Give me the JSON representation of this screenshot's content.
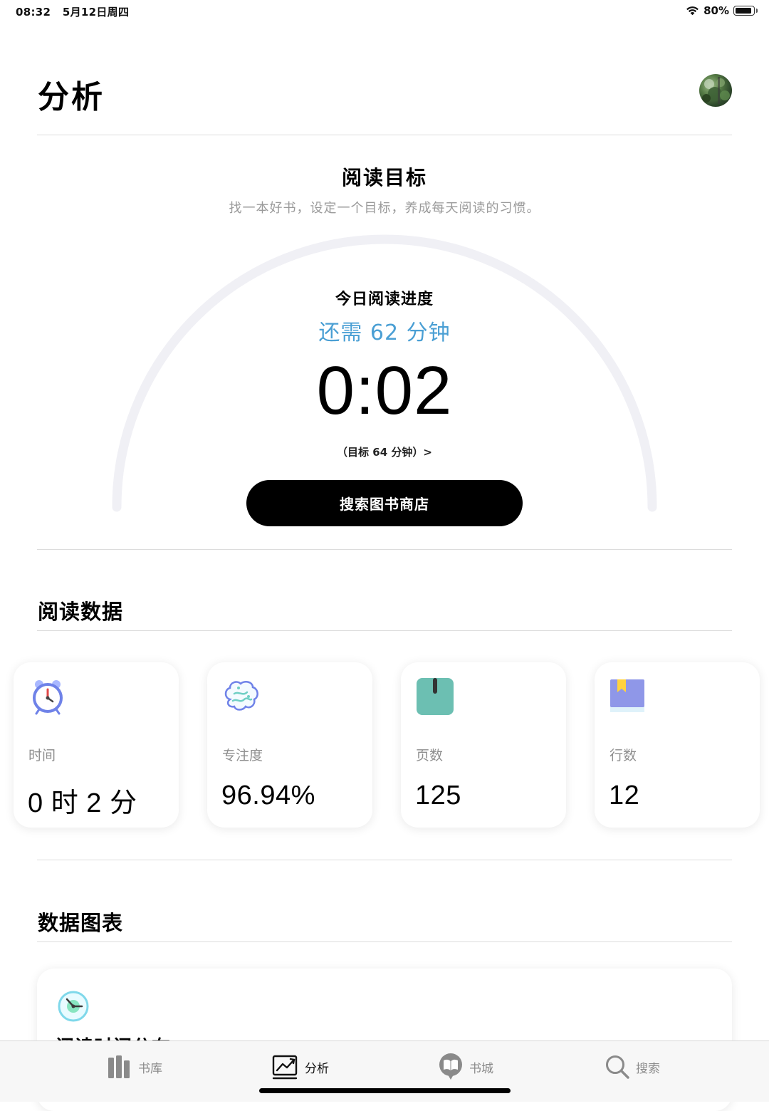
{
  "status_bar": {
    "time": "08:32",
    "date": "5月12日周四",
    "battery": "80%",
    "wifi_icon": "wifi-icon",
    "battery_icon": "battery-icon"
  },
  "header": {
    "title": "分析",
    "avatar_icon": "avatar"
  },
  "goal": {
    "title": "阅读目标",
    "subtitle": "找一本好书，设定一个目标，养成每天阅读的习惯。",
    "progress_label": "今日阅读进度",
    "remaining": "还需 62 分钟",
    "timer": "0:02",
    "target": "（目标 64 分钟）>",
    "button_label": "搜索图书商店",
    "progress_fraction": 0.03,
    "accent_color": "#4a9fd4"
  },
  "reading_data": {
    "title": "阅读数据",
    "cards": [
      {
        "label": "时间",
        "value": "0 时 2 分",
        "icon": "alarm-clock-icon"
      },
      {
        "label": "专注度",
        "value": "96.94%",
        "icon": "brain-icon"
      },
      {
        "label": "页数",
        "value": "125",
        "icon": "page-icon"
      },
      {
        "label": "行数",
        "value": "12",
        "icon": "bookmark-icon"
      }
    ]
  },
  "charts": {
    "title": "数据图表",
    "card_title": "阅读时间分布",
    "card_icon": "clock-icon"
  },
  "tab_bar": {
    "active": "分析",
    "tabs": [
      {
        "label": "书库",
        "icon": "library-icon"
      },
      {
        "label": "分析",
        "icon": "chart-icon"
      },
      {
        "label": "书城",
        "icon": "bookstore-icon"
      },
      {
        "label": "搜索",
        "icon": "search-icon"
      }
    ]
  }
}
